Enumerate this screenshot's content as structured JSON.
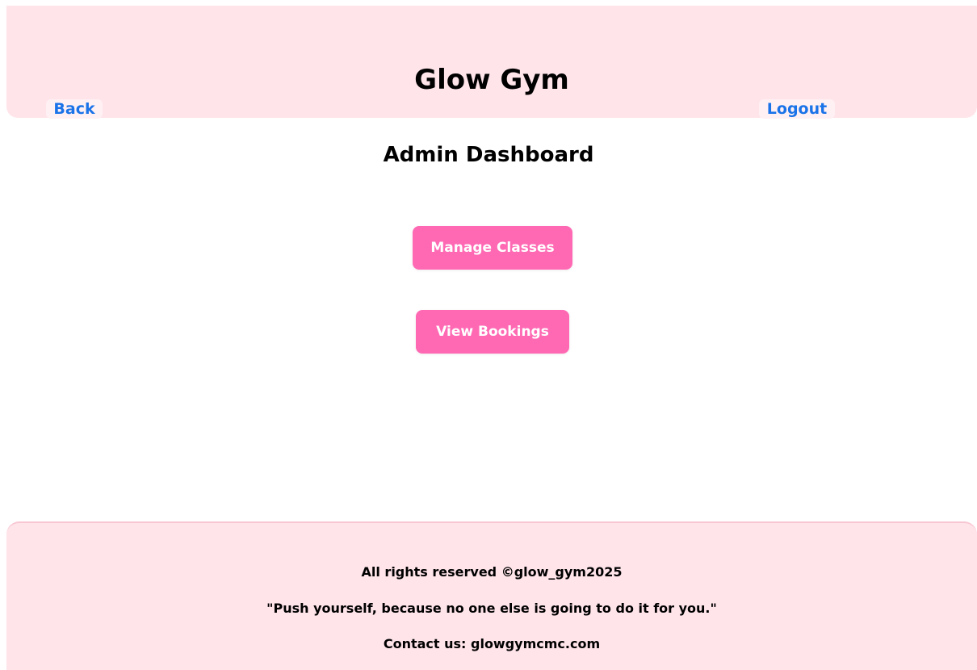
{
  "header": {
    "title": "Glow Gym",
    "back_label": "Back",
    "logout_label": "Logout"
  },
  "main": {
    "title": "Admin Dashboard",
    "buttons": [
      {
        "label": "Manage Classes"
      },
      {
        "label": "View Bookings"
      }
    ]
  },
  "footer": {
    "copyright": "All rights reserved ©glow_gym2025",
    "quote": "\"Push yourself, because no one else is going to do it for you.\"",
    "contact": "Contact us: glowgymcmc.com"
  },
  "colors": {
    "header_background": "#ffe4ea",
    "button_background": "#ff69b4",
    "link": "#1a73e8"
  }
}
